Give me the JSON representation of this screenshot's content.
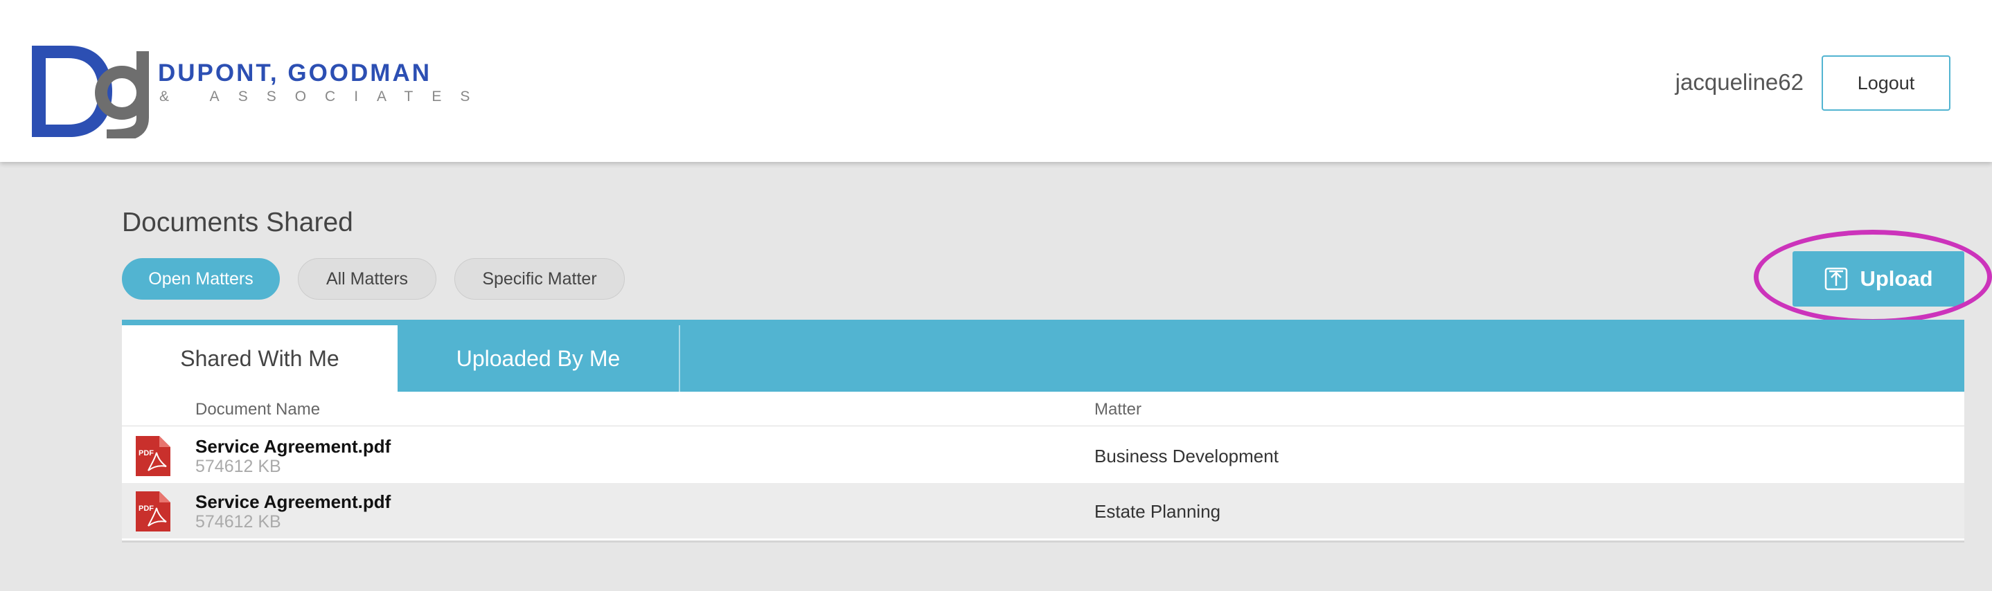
{
  "header": {
    "logo": {
      "name": "DUPONT, GOODMAN",
      "subtitle": "& ASSOCIATES",
      "brand_blue": "#2c4fb3",
      "brand_gray": "#6e6e6e"
    },
    "username": "jacqueline62",
    "logout_label": "Logout"
  },
  "main": {
    "title": "Documents Shared",
    "filters": [
      {
        "label": "Open Matters",
        "active": true
      },
      {
        "label": "All Matters",
        "active": false
      },
      {
        "label": "Specific Matter",
        "active": false
      }
    ],
    "upload_label": "Upload",
    "upload_icon": "upload-icon",
    "tabs": [
      {
        "label": "Shared With Me",
        "active": true
      },
      {
        "label": "Uploaded By Me",
        "active": false
      }
    ],
    "table": {
      "headers": {
        "document": "Document Name",
        "matter": "Matter"
      },
      "rows": [
        {
          "name": "Service Agreement.pdf",
          "size": "574612  KB",
          "matter": "Business Development",
          "icon": "pdf-file-icon"
        },
        {
          "name": "Service Agreement.pdf",
          "size": "574612  KB",
          "matter": "Estate Planning",
          "icon": "pdf-file-icon"
        }
      ]
    }
  },
  "colors": {
    "accent": "#52b4d1",
    "highlight_ring": "#cc33bb",
    "background": "#e6e6e6"
  }
}
